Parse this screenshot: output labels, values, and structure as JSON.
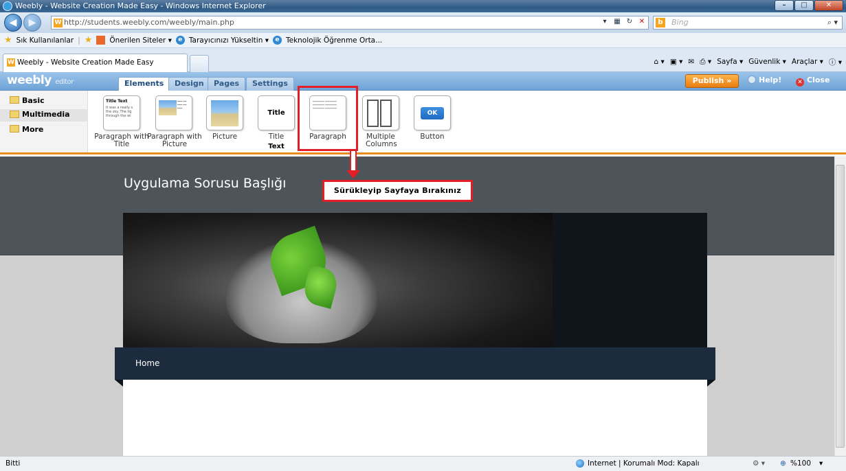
{
  "window": {
    "title": "Weebly - Website Creation Made Easy - Windows Internet Explorer"
  },
  "browser": {
    "url": "http://students.weebly.com/weebly/main.php",
    "search_placeholder": "Bing",
    "favorites": {
      "label": "Sık Kullanılanlar",
      "links": [
        "Önerilen Siteler ▾",
        "Tarayıcınızı Yükseltin ▾",
        "Teknolojik Öğrenme Orta..."
      ]
    },
    "tab": {
      "title": "Weebly - Website Creation Made Easy"
    },
    "commands": [
      "Sayfa ▾",
      "Güvenlik ▾",
      "Araçlar ▾"
    ]
  },
  "editor": {
    "logo": "weebly",
    "logo_suffix": "editor",
    "tabs": [
      "Elements",
      "Design",
      "Pages",
      "Settings"
    ],
    "active_tab": "Elements",
    "publish_label": "Publish »",
    "help_label": "Help!",
    "close_label": "Close",
    "categories": [
      "Basic",
      "Multimedia",
      "More"
    ],
    "elements": [
      {
        "label": "Paragraph with Title",
        "thumb_title": "Title Text",
        "thumb_text": "It was a really s the sky. The lig through the wi"
      },
      {
        "label": "Paragraph with Picture"
      },
      {
        "label": "Picture"
      },
      {
        "label": "Title",
        "thumb_title": "Title Text"
      },
      {
        "label": "Paragraph"
      },
      {
        "label": "Multiple Columns"
      },
      {
        "label": "Button",
        "thumb_title": "OK"
      }
    ]
  },
  "annotation": {
    "text": "Sürükleyip Sayfaya Bırakınız"
  },
  "site": {
    "title": "Uygulama Sorusu Başlığı",
    "nav_home": "Home"
  },
  "statusbar": {
    "left": "Bitti",
    "zone": "Internet | Korumalı Mod: Kapalı",
    "zoom": "%100"
  },
  "colors": {
    "accent_red": "#e21e26",
    "publish_orange": "#e77d11",
    "weebly_blue": "#6fa3d6",
    "site_dark": "#4d545a"
  }
}
